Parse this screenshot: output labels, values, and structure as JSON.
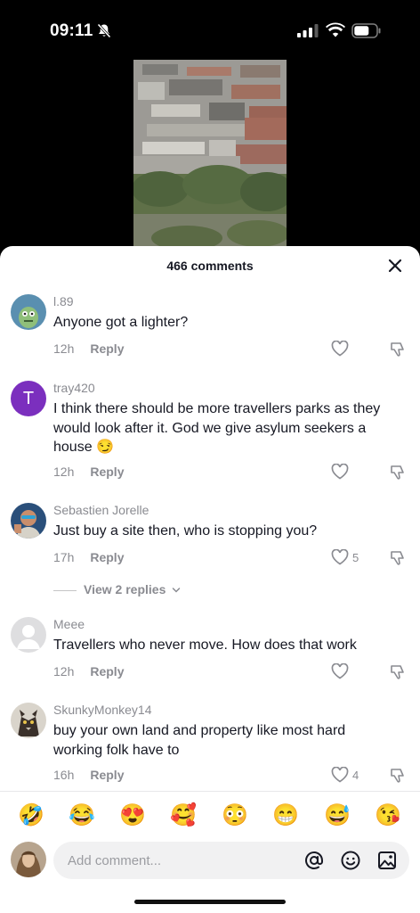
{
  "status_bar": {
    "time": "09:11"
  },
  "sheet": {
    "title": "466 comments"
  },
  "comments": [
    {
      "username": "l.89",
      "text": "Anyone got a lighter?",
      "time": "12h",
      "reply": "Reply",
      "likes": "",
      "avatar_color": "#5a8fb0"
    },
    {
      "username": "tray420",
      "text": "I think there should be more travellers parks as they would look after it. God we give asylum seekers a house 😏",
      "time": "12h",
      "reply": "Reply",
      "likes": "",
      "avatar_letter": "T",
      "avatar_color": "#7b2fbe"
    },
    {
      "username": "Sebastien Jorelle",
      "text": "Just buy a site then, who is stopping you?",
      "time": "17h",
      "reply": "Reply",
      "likes": "5",
      "avatar_color": "#2a4f7a"
    },
    {
      "username": "Meee",
      "text": "Travellers who never move. How does that work",
      "time": "12h",
      "reply": "Reply",
      "likes": "",
      "avatar_color": "#d4d4d6"
    },
    {
      "username": "SkunkyMonkey14",
      "text": "buy your own land and property like most hard working folk have to",
      "time": "16h",
      "reply": "Reply",
      "likes": "4",
      "avatar_color": "#6b5a4a"
    }
  ],
  "view_replies": "View 2 replies",
  "emojis": [
    "🤣",
    "😂",
    "😍",
    "🥰",
    "😳",
    "😁",
    "😅",
    "😘"
  ],
  "input": {
    "placeholder": "Add comment..."
  },
  "icons": {
    "close": "close-icon",
    "like": "heart-outline-icon",
    "dislike": "thumbs-down-icon",
    "mention": "at-icon",
    "emoji": "smiley-icon",
    "image": "image-icon"
  }
}
